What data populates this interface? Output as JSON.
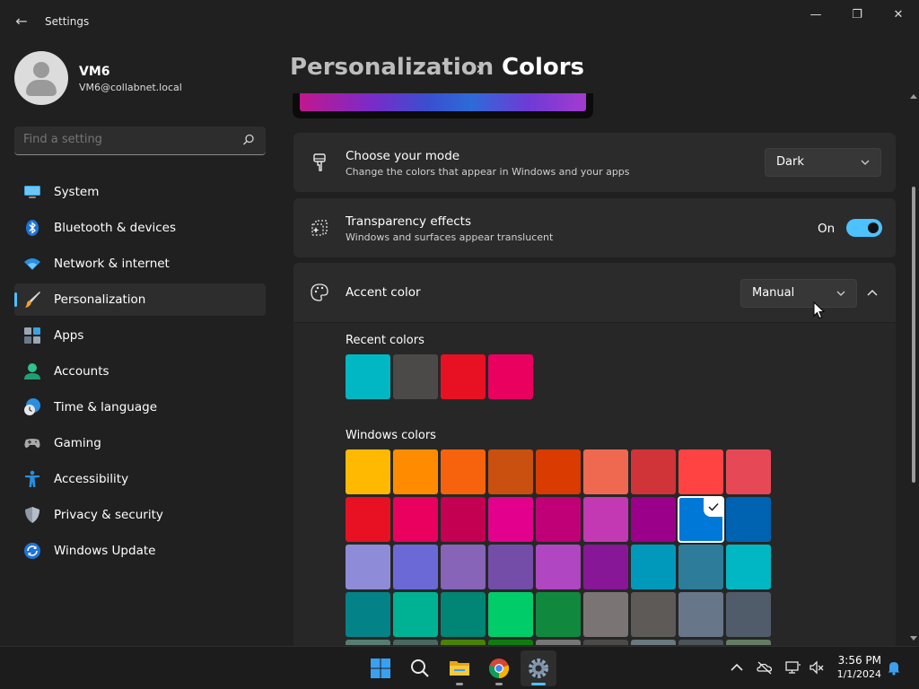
{
  "window": {
    "title": "Settings",
    "back_glyph": "←",
    "minimize_glyph": "—",
    "maximize_glyph": "❐",
    "close_glyph": "✕"
  },
  "profile": {
    "name": "VM6",
    "email": "VM6@collabnet.local"
  },
  "search": {
    "placeholder": "Find a setting"
  },
  "nav": {
    "items": [
      {
        "label": "System",
        "icon": "system-icon"
      },
      {
        "label": "Bluetooth & devices",
        "icon": "bluetooth-icon"
      },
      {
        "label": "Network & internet",
        "icon": "wifi-icon"
      },
      {
        "label": "Personalization",
        "icon": "paintbrush-icon",
        "active": true
      },
      {
        "label": "Apps",
        "icon": "apps-icon"
      },
      {
        "label": "Accounts",
        "icon": "accounts-icon"
      },
      {
        "label": "Time & language",
        "icon": "clock-globe-icon"
      },
      {
        "label": "Gaming",
        "icon": "gamepad-icon"
      },
      {
        "label": "Accessibility",
        "icon": "accessibility-icon"
      },
      {
        "label": "Privacy & security",
        "icon": "shield-icon"
      },
      {
        "label": "Windows Update",
        "icon": "update-icon"
      }
    ]
  },
  "breadcrumb": {
    "parent": "Personalization",
    "separator": "›",
    "current": "Colors"
  },
  "mode": {
    "title": "Choose your mode",
    "subtitle": "Change the colors that appear in Windows and your apps",
    "value": "Dark"
  },
  "transparency": {
    "title": "Transparency effects",
    "subtitle": "Windows and surfaces appear translucent",
    "state_label": "On",
    "enabled": true
  },
  "accent": {
    "title": "Accent color",
    "value": "Manual",
    "recent_label": "Recent colors",
    "recent_colors": [
      "#00b7c3",
      "#4c4a48",
      "#e81123",
      "#ea005e"
    ],
    "windows_label": "Windows colors",
    "windows_colors": [
      [
        "#ffb900",
        "#ff8c00",
        "#f7630c",
        "#ca5010",
        "#da3b01",
        "#ef6950",
        "#d13438",
        "#ff4343",
        "#e74856"
      ],
      [
        "#e81123",
        "#ea005e",
        "#c30052",
        "#e3008c",
        "#bf0077",
        "#c239b3",
        "#9a0089",
        "#0078d7",
        "#0063b1"
      ],
      [
        "#8e8cd8",
        "#6b69d6",
        "#8764b8",
        "#744da9",
        "#b146c2",
        "#881798",
        "#0099bc",
        "#2d7d9a",
        "#00b7c3"
      ],
      [
        "#038387",
        "#00b294",
        "#018574",
        "#00cc6a",
        "#10893e",
        "#7a7574",
        "#5d5a58",
        "#68768a",
        "#515c6b"
      ],
      [
        "#567c73",
        "#486860",
        "#498205",
        "#107c10",
        "#767676",
        "#4c4a48",
        "#69797e",
        "#4a5459",
        "#647c64"
      ]
    ],
    "selected_color": "#0078d7"
  },
  "taskbar": {
    "time": "3:56 PM",
    "date": "1/1/2024",
    "apps": [
      "start-icon",
      "search-icon",
      "file-explorer-icon",
      "chrome-icon",
      "settings-icon"
    ],
    "tray": [
      "chevron-up-icon",
      "onedrive-icon",
      "network-icon",
      "volume-muted-icon",
      "notification-bell-icon"
    ]
  },
  "colors": {
    "accent_blue": "#4cc2ff",
    "background": "#202020",
    "card": "#2b2b2b"
  }
}
